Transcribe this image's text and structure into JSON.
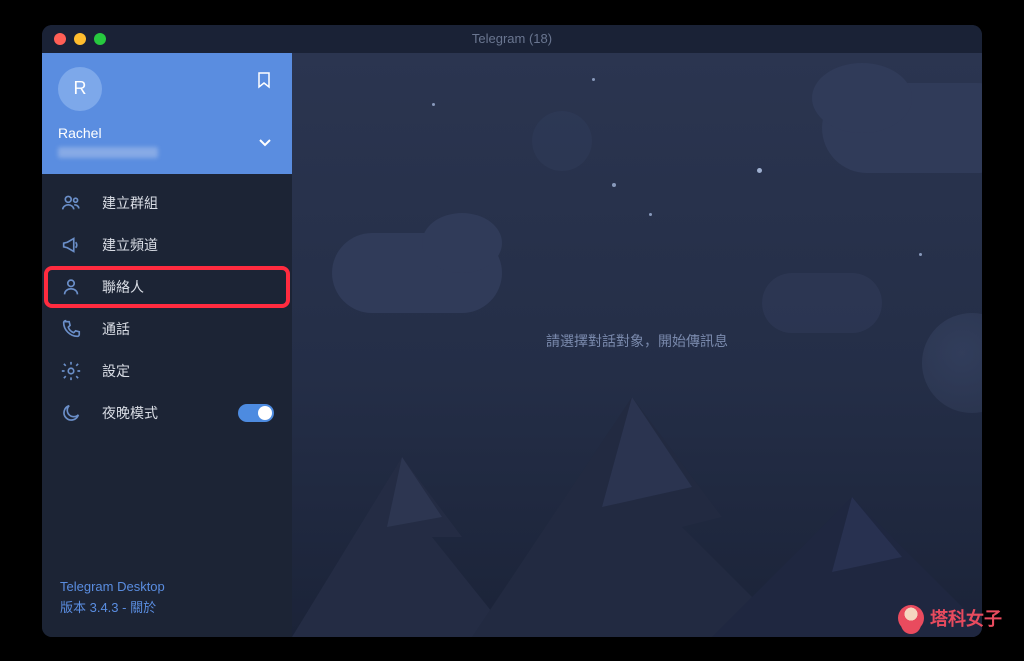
{
  "titlebar": {
    "title": "Telegram (18)"
  },
  "sidebar": {
    "avatar_initial": "R",
    "username": "Rachel",
    "menu": {
      "new_group": "建立群組",
      "new_channel": "建立頻道",
      "contacts": "聯絡人",
      "calls": "通話",
      "settings": "設定",
      "night_mode": "夜晚模式"
    },
    "night_mode_on": true,
    "footer": {
      "app_name": "Telegram Desktop",
      "version_line": "版本 3.4.3 - 關於"
    }
  },
  "main": {
    "empty_message": "請選擇對話對象，開始傳訊息"
  },
  "watermark": {
    "text": "塔科女子"
  }
}
